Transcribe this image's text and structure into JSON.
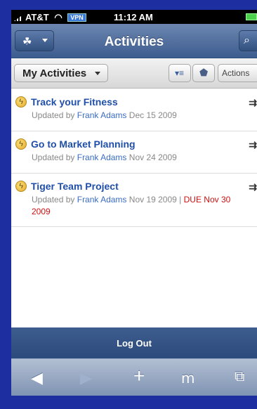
{
  "status_bar": {
    "carrier": "AT&T",
    "vpn": "VPN",
    "time": "11:12 AM"
  },
  "navbar": {
    "title": "Activities"
  },
  "toolbar": {
    "filter_label": "My Activities",
    "actions_label": "Actions"
  },
  "activities": [
    {
      "name": "Track your Fitness",
      "prefix": "Updated by",
      "who": "Frank Adams",
      "date": "Dec 15 2009",
      "due": ""
    },
    {
      "name": "Go to Market Planning",
      "prefix": "Updated by",
      "who": "Frank Adams",
      "date": "Nov 24 2009",
      "due": ""
    },
    {
      "name": "Tiger Team Project",
      "prefix": "Updated by",
      "who": "Frank Adams",
      "date": "Nov 19 2009",
      "due": "DUE Nov 30 2009"
    }
  ],
  "logout_label": "Log Out",
  "colors": {
    "link_blue": "#1f4fa8",
    "due_red": "#d01010",
    "navbar": "#4a6a9c"
  },
  "icons": [
    "signal-icon",
    "wifi-icon",
    "battery-icon",
    "network-menu-icon",
    "search-icon",
    "sort-icon",
    "tag-icon",
    "activity-status-icon",
    "chevron-icon",
    "back-icon",
    "forward-icon",
    "add-icon",
    "bookmarks-icon",
    "pages-icon"
  ]
}
